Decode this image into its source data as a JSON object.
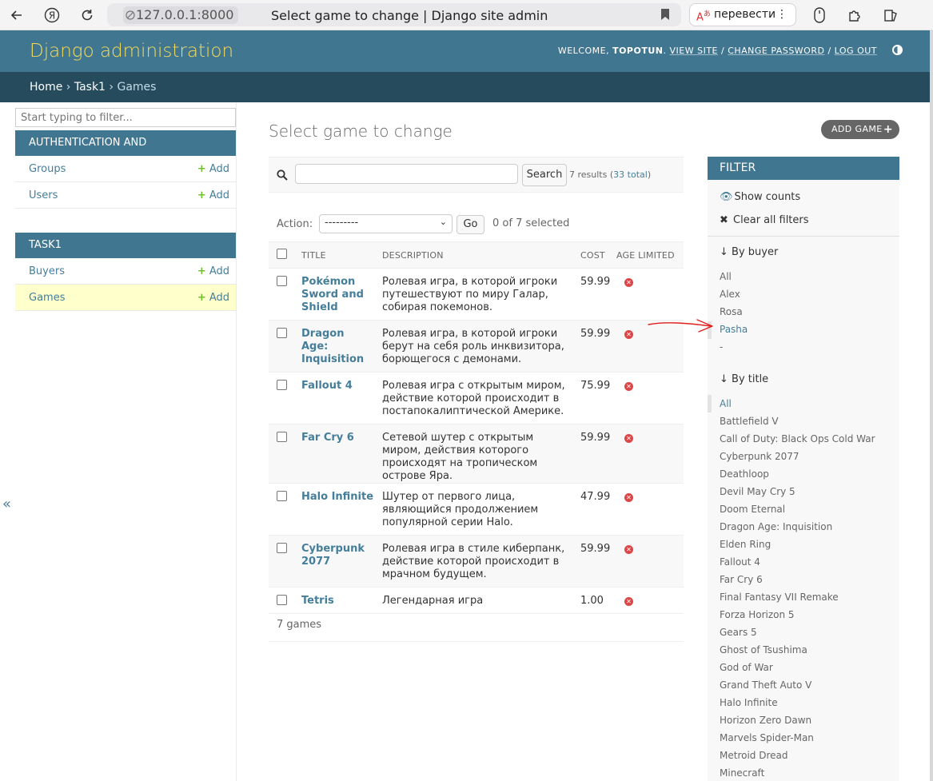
{
  "browser": {
    "url_host": "127.0.0.1:8000",
    "tab_title": "Select game to change | Django site admin",
    "translate_label": "перевести"
  },
  "header": {
    "branding": "Django administration",
    "welcome": "WELCOME,",
    "username": "TOPOTUN",
    "view_site": "VIEW SITE",
    "change_password": "CHANGE PASSWORD",
    "log_out": "LOG OUT"
  },
  "breadcrumbs": {
    "home": "Home",
    "app": "Task1",
    "current": "Games"
  },
  "sidebar": {
    "filter_placeholder": "Start typing to filter...",
    "modules": [
      {
        "caption": "AUTHENTICATION AND AUTHORIZATION",
        "models": [
          {
            "name": "Groups",
            "add": "Add"
          },
          {
            "name": "Users",
            "add": "Add"
          }
        ]
      },
      {
        "caption": "TASK1",
        "models": [
          {
            "name": "Buyers",
            "add": "Add"
          },
          {
            "name": "Games",
            "add": "Add"
          }
        ]
      }
    ],
    "collapse": "«"
  },
  "content": {
    "title": "Select game to change",
    "add_button": "ADD GAME",
    "search_button": "Search",
    "results": "7 results",
    "total": "33 total",
    "action_label": "Action:",
    "action_value": "---------",
    "go": "Go",
    "selected": "0 of 7 selected",
    "columns": [
      "TITLE",
      "DESCRIPTION",
      "COST",
      "AGE LIMITED"
    ],
    "rows": [
      {
        "title": "Pokémon Sword and Shield",
        "description": "Ролевая игра, в которой игроки путешествуют по миру Галар, собирая покемонов.",
        "cost": "59.99"
      },
      {
        "title": "Dragon Age: Inquisition",
        "description": "Ролевая игра, в которой игроки берут на себя роль инквизитора, борющегося с демонами.",
        "cost": "59.99"
      },
      {
        "title": "Fallout 4",
        "description": "Ролевая игра с открытым миром, действие которой происходит в постапокалиптической Америке.",
        "cost": "75.99"
      },
      {
        "title": "Far Cry 6",
        "description": "Сетевой шутер с открытым миром, действия которого происходят на тропическом острове Яра.",
        "cost": "59.99"
      },
      {
        "title": "Halo Infinite",
        "description": "Шутер от первого лица, являющийся продолжением популярной серии Halo.",
        "cost": "47.99"
      },
      {
        "title": "Cyberpunk 2077",
        "description": "Ролевая игра в стиле киберпанк, действие которой происходит в мрачном будущем.",
        "cost": "59.99"
      },
      {
        "title": "Tetris",
        "description": "Легендарная игра",
        "cost": "1.00"
      }
    ],
    "paginator": "7 games"
  },
  "filter": {
    "header": "FILTER",
    "show_counts": "Show counts",
    "clear_filters": "Clear all filters",
    "by_buyer": "↓ By buyer",
    "buyer_items": [
      "All",
      "Alex",
      "Rosa",
      "Pasha",
      "-"
    ],
    "by_title": "↓ By title",
    "title_items": [
      "All",
      "Battlefield V",
      "Call of Duty: Black Ops Cold War",
      "Cyberpunk 2077",
      "Deathloop",
      "Devil May Cry 5",
      "Doom Eternal",
      "Dragon Age: Inquisition",
      "Elden Ring",
      "Fallout 4",
      "Far Cry 6",
      "Final Fantasy VII Remake",
      "Forza Horizon 5",
      "Gears 5",
      "Ghost of Tsushima",
      "God of War",
      "Grand Theft Auto V",
      "Halo Infinite",
      "Horizon Zero Dawn",
      "Marvels Spider-Man",
      "Metroid Dread",
      "Minecraft"
    ]
  },
  "colors": {
    "header_bg": "#417690",
    "breadcrumb_bg": "#264b5d",
    "branding": "#f5dd5d",
    "link": "#447e9b",
    "add_plus": "#70bf2b",
    "no_icon": "#dd4646",
    "annotation_arrow": "#e02020"
  }
}
